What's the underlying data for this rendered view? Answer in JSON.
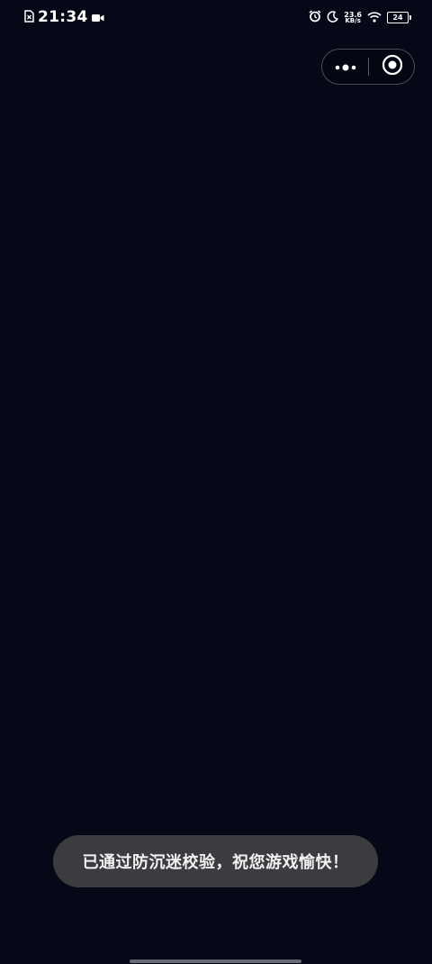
{
  "status_bar": {
    "time": "21:34",
    "net_speed_value": "23.6",
    "net_speed_unit": "KB/s",
    "battery_level": "24",
    "icons": [
      "sim-card-icon",
      "video-camera-icon",
      "alarm-icon",
      "moon-icon",
      "wifi-icon",
      "battery-icon"
    ]
  },
  "capsule": {
    "more_icon": "more-dots-icon",
    "close_icon": "target-circle-icon"
  },
  "toast": {
    "message": "已通过防沉迷校验，祝您游戏愉快！"
  },
  "colors": {
    "background": "#060818",
    "toast_background": "#3c3c40",
    "text": "#ffffff"
  }
}
